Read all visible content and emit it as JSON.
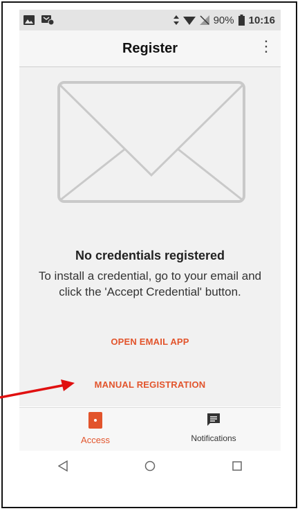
{
  "statusbar": {
    "battery": "90%",
    "time": "10:16"
  },
  "appbar": {
    "title": "Register",
    "menu_icon": "more-vert-icon"
  },
  "empty_state": {
    "icon": "envelope-icon",
    "title": "No credentials registered",
    "description": "To install a credential, go to your email and click the 'Accept Credential' button."
  },
  "actions": {
    "open_email": "OPEN EMAIL APP",
    "manual_registration": "MANUAL REGISTRATION"
  },
  "bottom_nav": {
    "access_label": "Access",
    "notifications_label": "Notifications"
  },
  "colors": {
    "accent": "#e2542c",
    "annotation": "#e01010"
  }
}
